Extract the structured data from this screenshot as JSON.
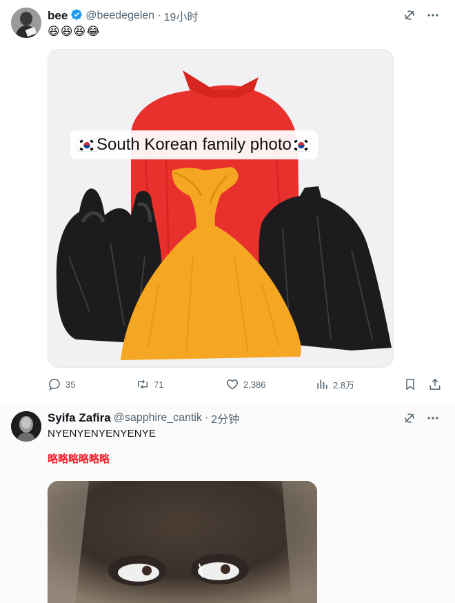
{
  "tweets": [
    {
      "name": "bee",
      "handle": "@beedegelen",
      "separator": "·",
      "time": "19小时",
      "text": "😆😆😆😂",
      "media_caption": "South Korean family photo",
      "stats": {
        "replies": "35",
        "retweets": "71",
        "likes": "2,386",
        "views": "2.8万"
      }
    },
    {
      "name": "Syifa Zafira",
      "handle": "@sapphire_cantik",
      "separator": "·",
      "time": "2分钟",
      "text": "NYENYENYENYENYE",
      "subtext": "略略略略略略"
    }
  ],
  "icons": {
    "verified": "verified-badge-icon",
    "grok": "grok-icon",
    "more": "more-icon",
    "reply": "reply-icon",
    "retweet": "retweet-icon",
    "like": "like-icon",
    "views": "views-icon",
    "bookmark": "bookmark-icon",
    "share": "share-icon"
  },
  "colors": {
    "text": "#0f1419",
    "secondary": "#536471",
    "verified": "#1d9bf0",
    "red_text": "#f4212e",
    "bag_red": "#e8302c",
    "bag_yellow": "#f5a623",
    "bag_black": "#1c1c1e"
  }
}
